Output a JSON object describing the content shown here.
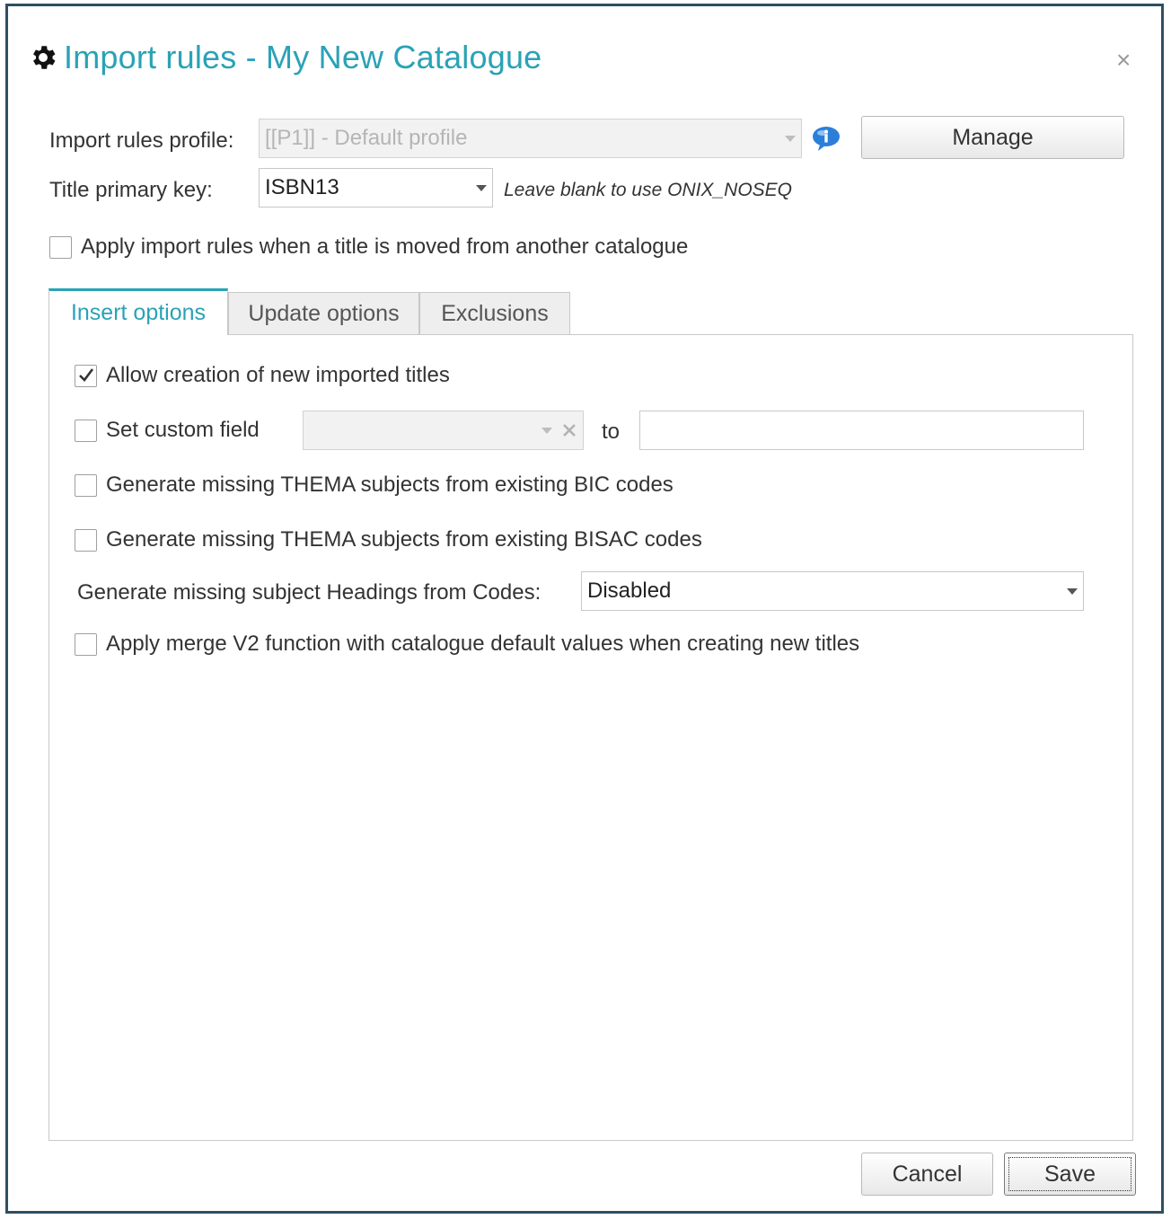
{
  "dialog": {
    "title": "Import rules - My New Catalogue",
    "title_icon": "gear-icon",
    "close_label": "×"
  },
  "profile": {
    "label": "Import rules profile:",
    "value": "[[P1]] - Default profile",
    "info_icon": "info-icon",
    "manage_label": "Manage"
  },
  "primary_key": {
    "label": "Title primary key:",
    "value": "ISBN13",
    "hint": "Leave blank to use ONIX_NOSEQ"
  },
  "apply_move": {
    "label": "Apply import rules when a title is moved from another catalogue",
    "checked": false
  },
  "tabs": [
    {
      "label": "Insert options",
      "active": true
    },
    {
      "label": "Update options",
      "active": false
    },
    {
      "label": "Exclusions",
      "active": false
    }
  ],
  "insert": {
    "allow_creation": {
      "label": "Allow creation of new imported titles",
      "checked": true
    },
    "custom_field": {
      "label": "Set custom field",
      "checked": false,
      "to_label": "to",
      "clear_icon": "clear-x-icon"
    },
    "thema_bic": {
      "label": "Generate missing THEMA subjects from existing BIC codes",
      "checked": false
    },
    "thema_bisac": {
      "label": "Generate missing THEMA subjects from existing BISAC codes",
      "checked": false
    },
    "headings": {
      "label": "Generate missing subject Headings from Codes:",
      "value": "Disabled"
    },
    "merge_v2": {
      "label": "Apply merge V2 function with catalogue default values when creating new titles",
      "checked": false
    }
  },
  "footer": {
    "cancel_label": "Cancel",
    "save_label": "Save"
  },
  "colors": {
    "accent": "#2aa2b6",
    "frame": "#2f4f62"
  }
}
